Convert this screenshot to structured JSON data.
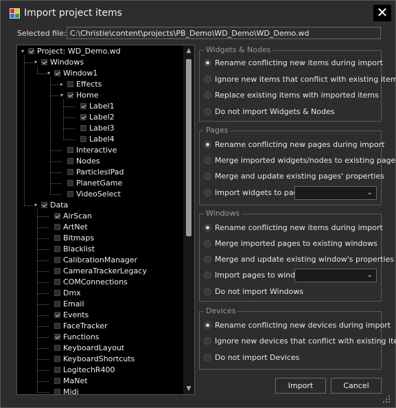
{
  "window": {
    "title": "Import project items",
    "close_glyph": "✕"
  },
  "selected_file": {
    "label": "Selected file:",
    "value": "C:\\Christie\\content\\projects\\PB_Demo\\WD_Demo\\WD_Demo.wd"
  },
  "tree": {
    "nodes": [
      {
        "label": "Project: WD_Demo.wd",
        "checked": true,
        "expanded": true
      },
      {
        "label": "Windows",
        "checked": true,
        "expanded": true
      },
      {
        "label": "Window1",
        "checked": true,
        "expanded": true
      },
      {
        "label": "Effects",
        "checked": false,
        "expanded": false
      },
      {
        "label": "Home",
        "checked": true,
        "expanded": true
      },
      {
        "label": "Label1",
        "checked": true
      },
      {
        "label": "Label2",
        "checked": true
      },
      {
        "label": "Label3",
        "checked": false
      },
      {
        "label": "Label4",
        "checked": false
      },
      {
        "label": "Interactive",
        "checked": false
      },
      {
        "label": "Nodes",
        "checked": false
      },
      {
        "label": "ParticlesIPad",
        "checked": false
      },
      {
        "label": "PlanetGame",
        "checked": false
      },
      {
        "label": "VideoSelect",
        "checked": false
      },
      {
        "label": "Data",
        "checked": true,
        "expanded": true
      },
      {
        "label": "AirScan",
        "checked": true
      },
      {
        "label": "ArtNet",
        "checked": false
      },
      {
        "label": "Bitmaps",
        "checked": false
      },
      {
        "label": "Blacklist",
        "checked": false
      },
      {
        "label": "CalibrationManager",
        "checked": false
      },
      {
        "label": "CameraTrackerLegacy",
        "checked": false
      },
      {
        "label": "COMConnections",
        "checked": false
      },
      {
        "label": "Dmx",
        "checked": false
      },
      {
        "label": "Email",
        "checked": false
      },
      {
        "label": "Events",
        "checked": true
      },
      {
        "label": "FaceTracker",
        "checked": false
      },
      {
        "label": "Functions",
        "checked": true
      },
      {
        "label": "KeyboardLayout",
        "checked": false
      },
      {
        "label": "KeyboardShortcuts",
        "checked": false
      },
      {
        "label": "LogitechR400",
        "checked": false
      },
      {
        "label": "MaNet",
        "checked": false
      },
      {
        "label": "Midi",
        "checked": false
      }
    ]
  },
  "groups": {
    "widgets_nodes": {
      "title": "Widgets & Nodes",
      "options": [
        {
          "label": "Rename conflicting new items during import",
          "selected": true
        },
        {
          "label": "Ignore new items that conflict with existing items",
          "selected": false
        },
        {
          "label": "Replace existing items with imported items",
          "selected": false
        },
        {
          "label": "Do not import Widgets & Nodes",
          "selected": false
        }
      ]
    },
    "pages": {
      "title": "Pages",
      "options": [
        {
          "label": "Rename conflicting new pages during import",
          "selected": true
        },
        {
          "label": "Merge imported widgets/nodes to existing page",
          "selected": false
        },
        {
          "label": "Merge and update existing pages' properties",
          "selected": false
        },
        {
          "label": "Import widgets to page:",
          "selected": false
        }
      ],
      "combo_value": ""
    },
    "windows": {
      "title": "Windows",
      "options": [
        {
          "label": "Rename conflicting new items during import",
          "selected": true
        },
        {
          "label": "Merge imported pages to existing windows",
          "selected": false
        },
        {
          "label": "Merge and update existing window's properties",
          "selected": false
        },
        {
          "label": "Import pages to window:",
          "selected": false
        },
        {
          "label": "Do not import Windows",
          "selected": false
        }
      ],
      "combo_value": ""
    },
    "devices": {
      "title": "Devices",
      "options": [
        {
          "label": "Rename conflicting new devices during import",
          "selected": true
        },
        {
          "label": "Ignore new devices that conflict with existing items",
          "selected": false
        },
        {
          "label": "Do not import Devices",
          "selected": false
        }
      ]
    }
  },
  "buttons": {
    "import": "Import",
    "cancel": "Cancel"
  },
  "colors": {
    "background": "#2d2d2d",
    "tree_bg": "#000000",
    "group_title": "#9a9a9a",
    "text": "#e8e8e8"
  }
}
